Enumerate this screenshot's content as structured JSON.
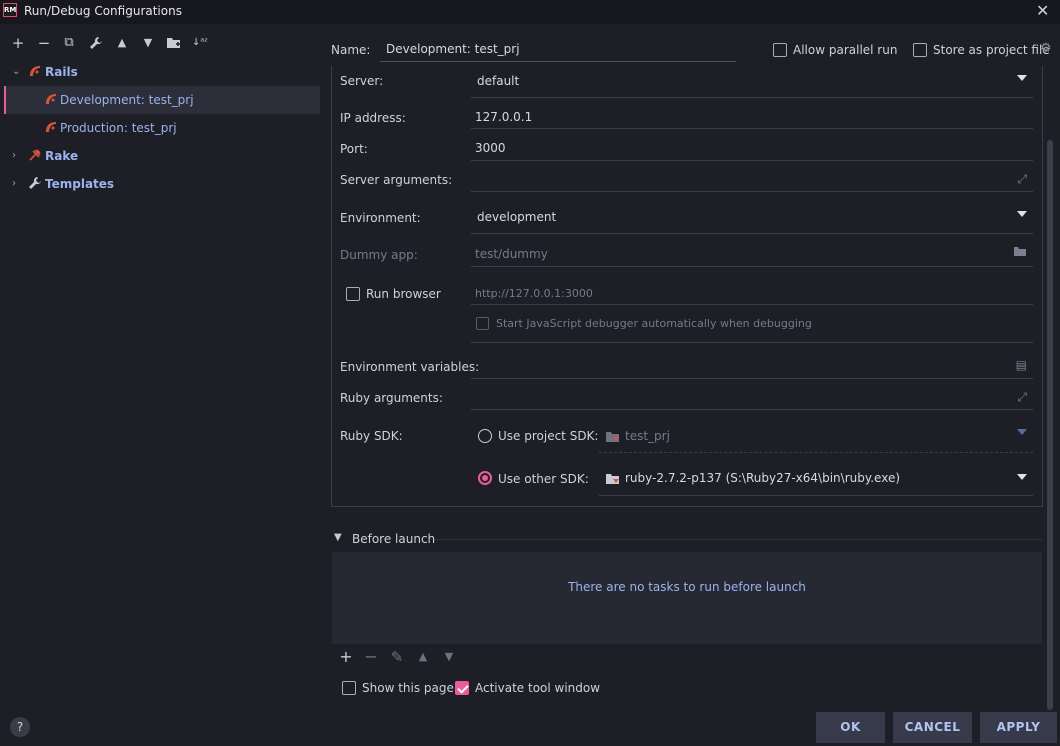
{
  "window": {
    "title": "Run/Debug Configurations",
    "app_badge": "RM"
  },
  "tree": {
    "rails": "Rails",
    "development": "Development: test_prj",
    "production": "Production: test_prj",
    "rake": "Rake",
    "templates": "Templates"
  },
  "header": {
    "name_label": "Name:",
    "name_value": "Development: test_prj",
    "allow_parallel": "Allow parallel run",
    "store_project": "Store as project file"
  },
  "form": {
    "server_label": "Server:",
    "server_value": "default",
    "ip_label": "IP address:",
    "ip_value": "127.0.0.1",
    "port_label": "Port:",
    "port_value": "3000",
    "server_args_label": "Server arguments:",
    "environment_label": "Environment:",
    "environment_value": "development",
    "dummy_label": "Dummy app:",
    "dummy_value": "test/dummy",
    "run_browser_label": "Run browser",
    "run_browser_url": "http://127.0.0.1:3000",
    "js_debugger_label": "Start JavaScript debugger automatically when debugging",
    "env_vars_label": "Environment variables:",
    "ruby_args_label": "Ruby arguments:",
    "ruby_sdk_label": "Ruby SDK:",
    "use_project_sdk": "Use project SDK:",
    "project_sdk_value": "test_prj",
    "use_other_sdk": "Use other SDK:",
    "other_sdk_value": "ruby-2.7.2-p137 (S:\\Ruby27-x64\\bin\\ruby.exe)"
  },
  "before_launch": {
    "title": "Before launch",
    "empty_message": "There are no tasks to run before launch"
  },
  "footer": {
    "show_page": "Show this page",
    "activate_tool": "Activate tool window",
    "ok": "OK",
    "cancel": "CANCEL",
    "apply": "APPLY",
    "help": "?"
  },
  "colors": {
    "accent": "#e85d9c",
    "link": "#9cb3ec",
    "background": "#1e1f26"
  }
}
